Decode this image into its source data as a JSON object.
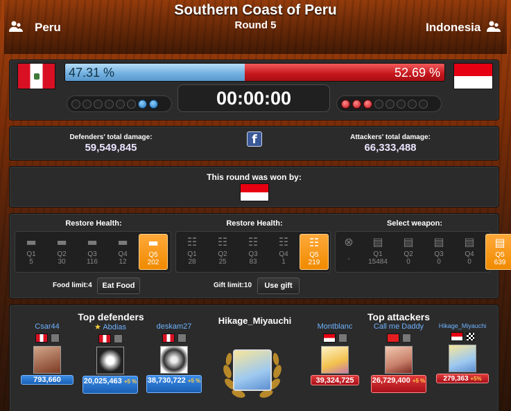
{
  "battle": {
    "title": "Southern Coast of Peru",
    "round": "Round 5",
    "defender": "Peru",
    "attacker": "Indonesia",
    "def_percent": "47.31 %",
    "att_percent": "52.69 %",
    "def_share": 47.31,
    "timer": "00:00:00",
    "def_rounds_won": 2,
    "att_rounds_won": 3,
    "total_rounds": 8
  },
  "damage": {
    "def_label": "Defenders' total damage:",
    "def_value": "59,549,845",
    "att_label": "Attackers' total damage:",
    "att_value": "66,333,488",
    "share_icon": "facebook-icon"
  },
  "winner": {
    "label": "This round was won by:",
    "country_flag": "indonesia-flag"
  },
  "health": {
    "food": {
      "title": "Restore Health:",
      "icon": "bread-icon",
      "slots": [
        {
          "q": "Q1",
          "n": "5"
        },
        {
          "q": "Q2",
          "n": "30"
        },
        {
          "q": "Q3",
          "n": "116"
        },
        {
          "q": "Q4",
          "n": "12"
        },
        {
          "q": "Q5",
          "n": "202"
        }
      ],
      "limit_label": "Food limit:4",
      "button": "Eat Food"
    },
    "gift": {
      "title": "Restore Health:",
      "icon": "gift-icon",
      "slots": [
        {
          "q": "Q1",
          "n": "28"
        },
        {
          "q": "Q2",
          "n": "25"
        },
        {
          "q": "Q3",
          "n": "83"
        },
        {
          "q": "Q4",
          "n": "1"
        },
        {
          "q": "Q5",
          "n": "219"
        }
      ],
      "limit_label": "Gift limit:10",
      "button": "Use gift"
    },
    "weapon": {
      "title": "Select weapon:",
      "icon": "tank-icon",
      "none_label": "-",
      "slots": [
        {
          "q": "Q1",
          "n": "15484"
        },
        {
          "q": "Q2",
          "n": "0"
        },
        {
          "q": "Q3",
          "n": "0"
        },
        {
          "q": "Q4",
          "n": "0"
        },
        {
          "q": "Q5",
          "n": "639"
        }
      ]
    }
  },
  "top": {
    "defenders_title": "Top defenders",
    "attackers_title": "Top attackers",
    "center_player": "Hikage_Miyauchi",
    "defenders": [
      {
        "name": "Csar44",
        "damage": "793,660",
        "bonus": ""
      },
      {
        "name": "Abdias",
        "damage": "20,025,463",
        "bonus": "+5 %"
      },
      {
        "name": "deskam27",
        "damage": "38,730,722",
        "bonus": "+5 %"
      }
    ],
    "attackers": [
      {
        "name": "Montblanc",
        "damage": "39,324,725",
        "bonus": ""
      },
      {
        "name": "Call me Daddy",
        "damage": "26,729,400",
        "bonus": "+5 %"
      },
      {
        "name": "Hikage_Miyauchi",
        "damage": "279,363",
        "bonus": "+5%"
      }
    ]
  },
  "colors": {
    "defender": "#6faedf",
    "attacker": "#c4161c",
    "selected": "#f08a00"
  }
}
